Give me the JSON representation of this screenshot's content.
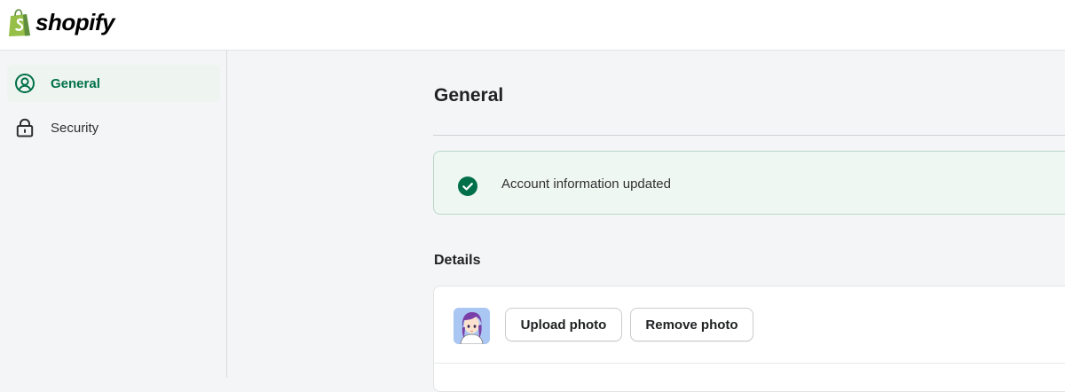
{
  "brand": {
    "name": "shopify",
    "bag_color": "#95bf47"
  },
  "sidebar": {
    "items": [
      {
        "label": "General",
        "icon": "user-circle-icon",
        "active": true
      },
      {
        "label": "Security",
        "icon": "lock-icon",
        "active": false
      }
    ]
  },
  "main": {
    "title": "General",
    "banner": {
      "icon": "check-circle-icon",
      "message": "Account information updated",
      "color": "#00704a"
    },
    "details": {
      "title": "Details",
      "avatar": "avatar",
      "upload_label": "Upload photo",
      "remove_label": "Remove photo"
    }
  },
  "colors": {
    "accent": "#00704a",
    "banner_bg": "#eff7f3",
    "page_bg": "#f4f5f7"
  }
}
